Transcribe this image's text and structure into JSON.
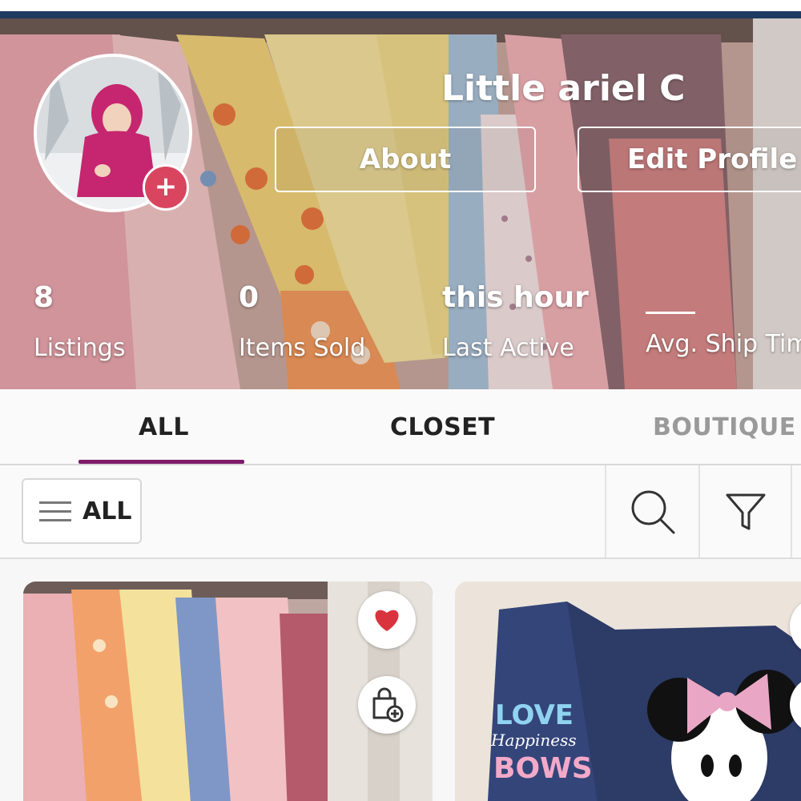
{
  "profile": {
    "name": "Little ariel C",
    "about_label": "About",
    "edit_label": "Edit Profile"
  },
  "stats": [
    {
      "value": "8",
      "label": "Listings"
    },
    {
      "value": "0",
      "label": "Items Sold"
    },
    {
      "value": "this hour",
      "label": "Last Active"
    },
    {
      "value": "",
      "label": "Avg. Ship Time"
    }
  ],
  "tabs": [
    {
      "label": "ALL",
      "active": true
    },
    {
      "label": "CLOSET",
      "active": false
    },
    {
      "label": "BOUTIQUE",
      "active": false
    }
  ],
  "filter": {
    "label": "ALL"
  },
  "listings": [
    {
      "image": "closet-dresses-photo",
      "liked": true
    },
    {
      "image": "minnie-mouse-sweatshirt-photo",
      "print_lines": [
        "LOVE",
        "Happiness",
        "BOWS"
      ]
    }
  ],
  "colors": {
    "accent": "#7f1b6a",
    "like": "#d9343d",
    "avatar_add": "#d9455f",
    "top_bar": "#1e3a5f"
  },
  "icons": {
    "avatar_add": "+",
    "filter_menu": "hamburger-icon",
    "search": "search-icon",
    "filter": "funnel-icon",
    "like": "heart-icon",
    "add_to_bundle": "shopping-bag-plus-icon"
  }
}
